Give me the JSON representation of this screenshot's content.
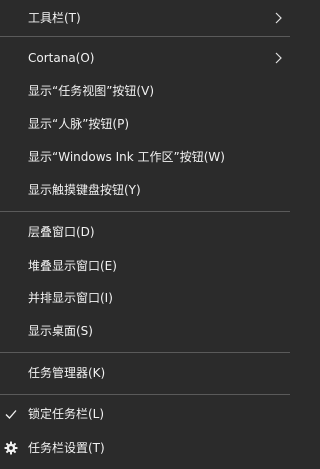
{
  "menu": {
    "items": [
      {
        "label": "工具栏(T)",
        "chevron": "chevron-right-icon"
      },
      {
        "label": "Cortana(O)",
        "chevron": "chevron-right-icon"
      },
      {
        "label": "显示“任务视图”按钮(V)"
      },
      {
        "label": "显示“人脉”按钮(P)"
      },
      {
        "label": "显示“Windows Ink 工作区”按钮(W)"
      },
      {
        "label": "显示触摸键盘按钮(Y)"
      },
      {
        "label": "层叠窗口(D)"
      },
      {
        "label": "堆叠显示窗口(E)"
      },
      {
        "label": "并排显示窗口(I)"
      },
      {
        "label": "显示桌面(S)"
      },
      {
        "label": "任务管理器(K)"
      },
      {
        "label": "锁定任务栏(L)",
        "icon": "checkmark-icon"
      },
      {
        "label": "任务栏设置(T)",
        "icon": "gear-icon"
      }
    ]
  },
  "colors": {
    "background": "#2b2b2b",
    "text": "#f2f2f2",
    "separator": "#5a5a5a"
  }
}
